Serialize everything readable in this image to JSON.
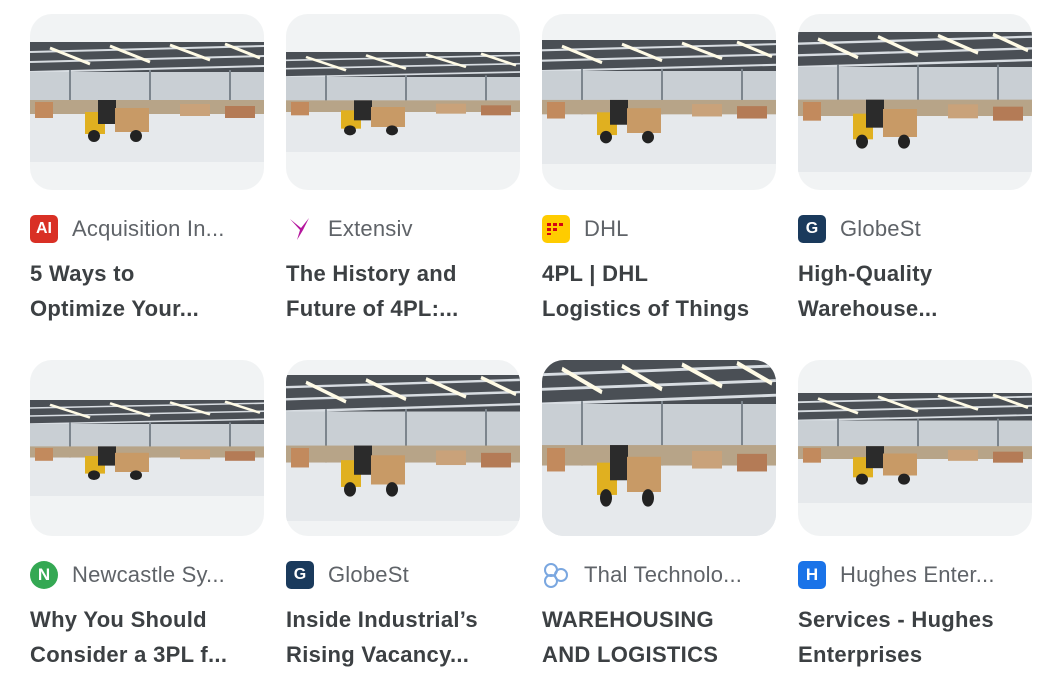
{
  "results": [
    {
      "source": "Acquisition In...",
      "title_line1": "5 Ways to",
      "title_line2": "Optimize Your...",
      "favicon": "acquisition-icon",
      "favicon_text": "AI",
      "favicon_color": "#d93025"
    },
    {
      "source": "Extensiv",
      "title_line1": "The History and",
      "title_line2": "Future of 4PL:...",
      "favicon": "extensiv-icon",
      "favicon_text": "",
      "favicon_color": "#9c27b0"
    },
    {
      "source": "DHL",
      "title_line1": "4PL | DHL",
      "title_line2": "Logistics of Things",
      "favicon": "dhl-icon",
      "favicon_text": "",
      "favicon_color": "#ffcc00"
    },
    {
      "source": "GlobeSt",
      "title_line1": "High-Quality",
      "title_line2": "Warehouse...",
      "favicon": "globest-icon",
      "favicon_text": "G",
      "favicon_color": "#1a3a5c"
    },
    {
      "source": "Newcastle Sy...",
      "title_line1": "Why You Should",
      "title_line2": "Consider a 3PL f...",
      "favicon": "newcastle-icon",
      "favicon_text": "N",
      "favicon_color": "#34a853"
    },
    {
      "source": "GlobeSt",
      "title_line1": "Inside Industrial’s",
      "title_line2": "Rising Vacancy...",
      "favicon": "globest-icon",
      "favicon_text": "G",
      "favicon_color": "#1a3a5c"
    },
    {
      "source": "Thal Technolo...",
      "title_line1": "WAREHOUSING",
      "title_line2": "AND LOGISTICS",
      "favicon": "thal-icon",
      "favicon_text": "",
      "favicon_color": "#8ab4f8"
    },
    {
      "source": "Hughes Enter...",
      "title_line1": "Services - Hughes",
      "title_line2": "Enterprises",
      "favicon": "hughes-icon",
      "favicon_text": "H",
      "favicon_color": "#1a73e8"
    }
  ]
}
